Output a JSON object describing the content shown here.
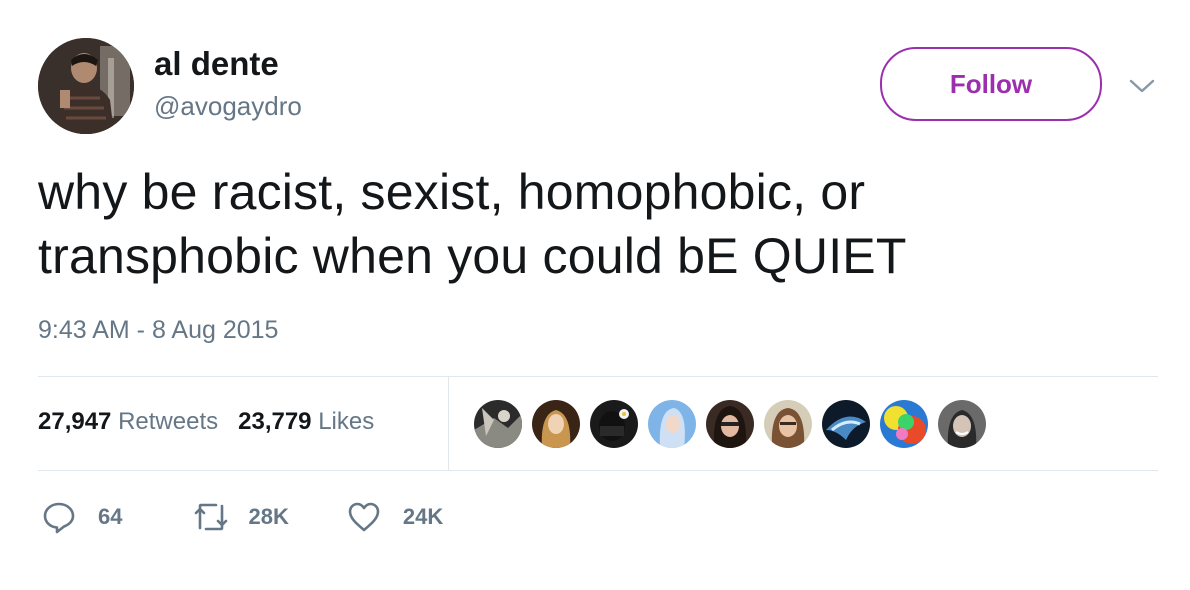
{
  "user": {
    "name": "al dente",
    "handle": "@avogaydro"
  },
  "follow_button": {
    "label": "Follow",
    "color": "#9b2fae"
  },
  "menu": {
    "icon": "chevron-down-icon"
  },
  "tweet": {
    "text_lines": [
      "why be racist, sexist, homophobic, or",
      "transphobic when you could bE QUIET"
    ],
    "timestamp": "9:43 AM - 8 Aug 2015"
  },
  "stats": {
    "retweets_count": "27,947",
    "retweets_label": "Retweets",
    "likes_count": "23,779",
    "likes_label": "Likes"
  },
  "likers": [
    {
      "icon": "liker-avatar-1"
    },
    {
      "icon": "liker-avatar-2"
    },
    {
      "icon": "liker-avatar-3"
    },
    {
      "icon": "liker-avatar-4"
    },
    {
      "icon": "liker-avatar-5"
    },
    {
      "icon": "liker-avatar-6"
    },
    {
      "icon": "liker-avatar-7"
    },
    {
      "icon": "liker-avatar-8"
    },
    {
      "icon": "liker-avatar-9"
    }
  ],
  "actions": {
    "reply": {
      "icon": "reply-icon",
      "count": "64"
    },
    "retweet": {
      "icon": "retweet-icon",
      "count": "28K"
    },
    "like": {
      "icon": "heart-icon",
      "count": "24K"
    }
  },
  "colors": {
    "text": "#14171a",
    "secondary": "#657786",
    "divider": "#e1e8ed",
    "accent": "#9b2fae"
  }
}
